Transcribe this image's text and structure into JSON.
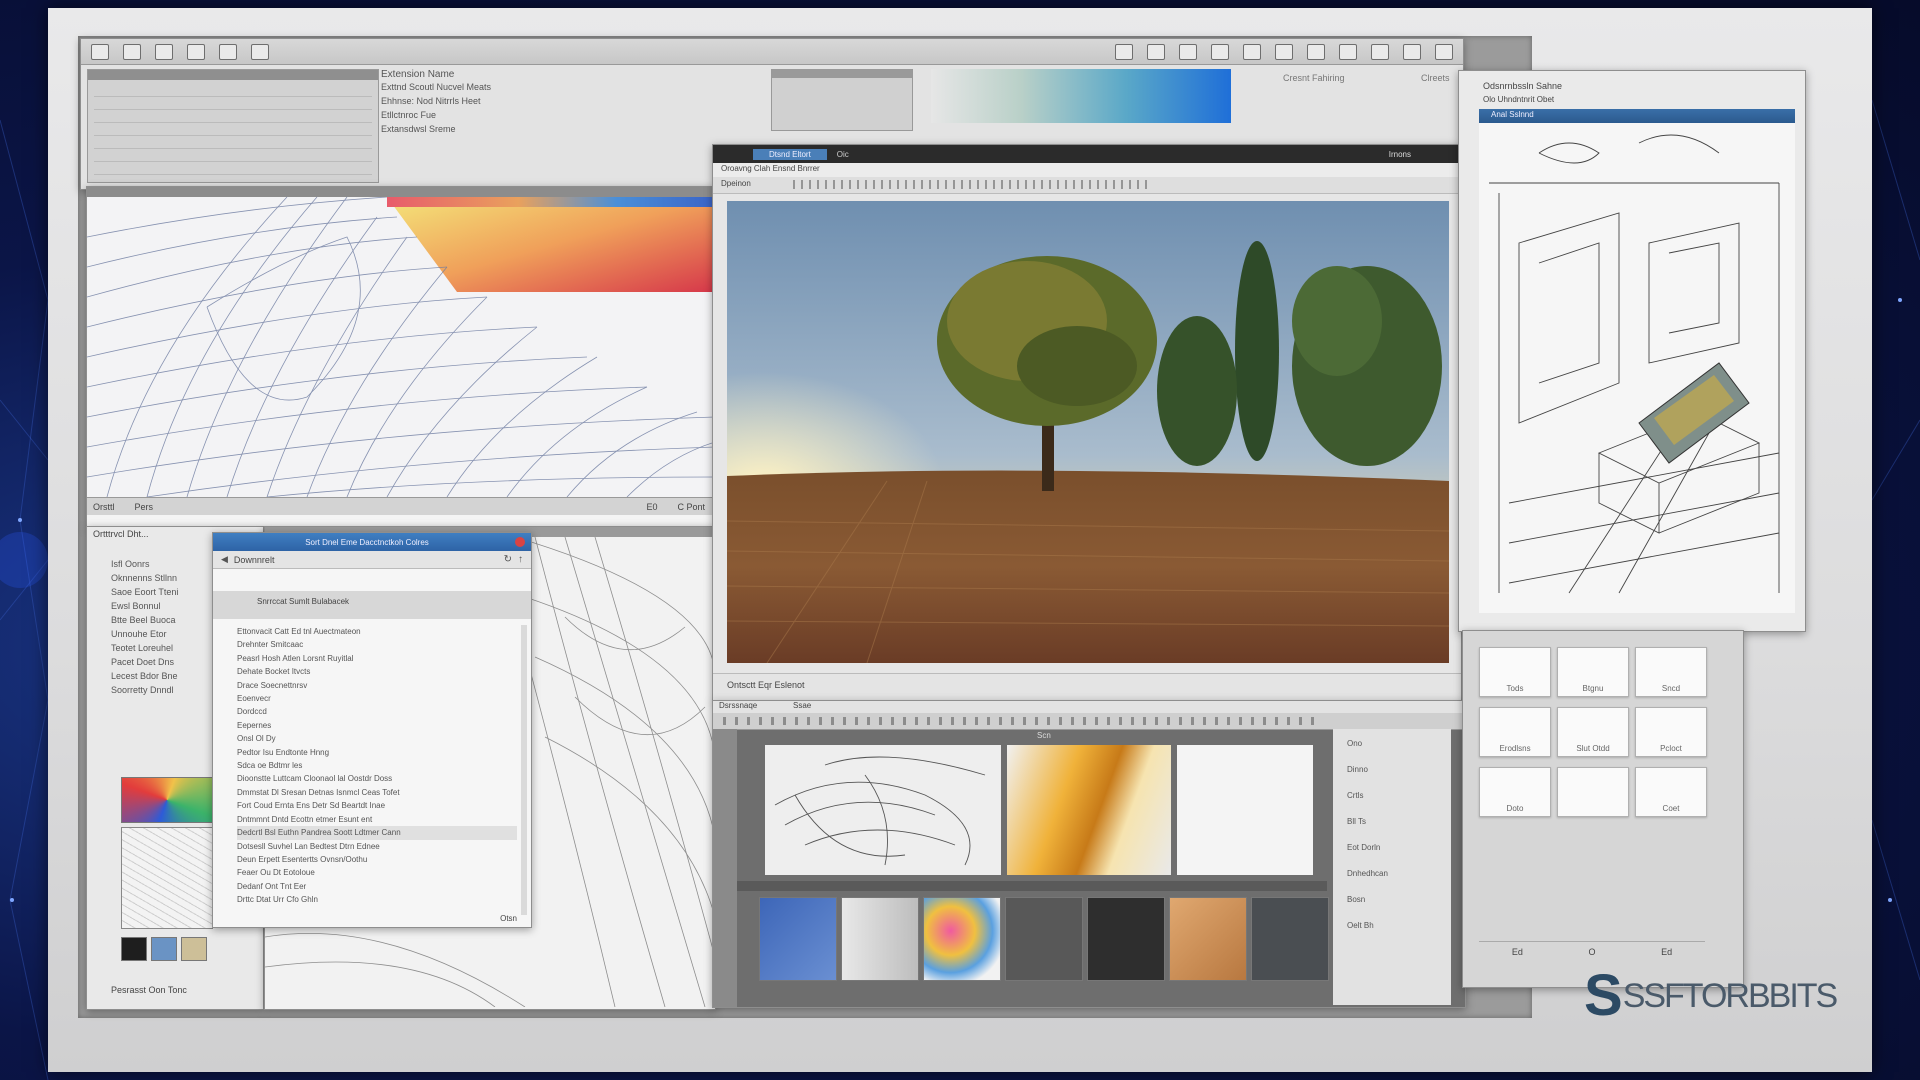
{
  "brand": {
    "logo_letter": "S",
    "logo_text": "SSFTORBBITS"
  },
  "colors": {
    "background": "#0b1547",
    "accent_blue": "#3a6fa8",
    "logo": "#2c4a64"
  },
  "top_window": {
    "panel_title": "Extension Name",
    "list_rows": [
      "Exttnd Scoutl Nucvel Meats",
      "Ehhnse: Nod Nitrrls Heet",
      "Etllctnroc Fue",
      "Extansdwsl Sreme"
    ],
    "right_label": "Clreets",
    "gradient_label": "Cresnt Fahiring"
  },
  "mesh_window": {
    "status_left": "Orsttl",
    "status_mid": "Pers",
    "status_value": "E0",
    "status_right": "C Pont"
  },
  "file_dialog": {
    "title": "Sort Dnel Eme Dacctnctkoh Colres",
    "path_label": "Downnrelt",
    "section": "Snrrccat Sumlt Bulabacek",
    "items": [
      "Ettonvacit Catt Ed tnl Auectmateon",
      "Drehnter Smitcaac",
      "Peasrl Hosh Atlen Lorsnt Ruyitlal",
      "Dehate Bocket Itvcts",
      "Drace Soecnettnrsv",
      "Eoenvecr",
      "Dordccd",
      "Eepernes",
      "Onsl Ol Dy",
      "Pedtor Isu Endtonte Hnng",
      "Sdca oe Bdtmr les",
      "Dioonstte Luttcam Cloonaol lal Oostdr Doss",
      "Dmmstat Dl Sresan Detnas Isnmcl Ceas Tofet",
      "Fort Coud Ernta Ens Detr Sd Beartdt Inae",
      "Dntmmnt Dntd Ecottn etmer Esunt ent",
      "Dedcrtl Bsl Euthn Pandrea Soott Ldtmer Cann",
      "Dotsesll Suvhel Lan Bedtest Dtrn Ednee",
      "Deun Erpett Esentertts Ovnsn/Oothu",
      "Feaer Ou Dt Eotoloue",
      "Dedanf Ont Tnt Eer",
      "Drttc Dtat Urr Cfo Ghln"
    ],
    "footer_right": "Otsn"
  },
  "left_panel": {
    "header": "Ortttrvcl Dht...",
    "rows": [
      "Isfl Oonrs",
      "Oknnenns Stllnn",
      "Saoe Eoort Tteni",
      "Ewsl Bonnul",
      "Btte Beel Buoca",
      "Unnouhe Etor",
      "Teotet Loreuhel",
      "Pacet Doet Dns",
      "Lecest Bdor Bne",
      "Soorretty Dnndl"
    ],
    "bottom_label": "Pesrasst Oon Tonc"
  },
  "photo_window": {
    "tab_active": "Dtsnd Eltort",
    "tab_other": "Oic",
    "right_label": "Irnons",
    "menu_label": "Oroavng Clah Ensnd Bnrrer",
    "toolbar_label": "Dpeinon",
    "status": "Ontsctt Eqr Eslenot"
  },
  "bottom_window": {
    "menu_left": "Dsrssnaqe",
    "menu_mid": "Ssae",
    "title": "Scn",
    "side_labels": [
      "Ono",
      "Dinno",
      "Crtls",
      "Bll Ts",
      "Eot Dorln",
      "Dnhedhcan",
      "Bosn",
      "Oelt Bh"
    ]
  },
  "sketch_window": {
    "top_label": "Odsnrnbssln Sahne",
    "sub_label": "Olo  Uhndntnrit Obet",
    "title": "Anal Sslnnd"
  },
  "icon_grid": {
    "tiles": [
      "Tods",
      "Btgnu",
      "Sncd",
      "Erodlsns",
      "Slut Otdd",
      "Pcloct",
      "Doto",
      "",
      "Coet"
    ],
    "footer": [
      "Ed",
      "O",
      "Ed"
    ]
  }
}
